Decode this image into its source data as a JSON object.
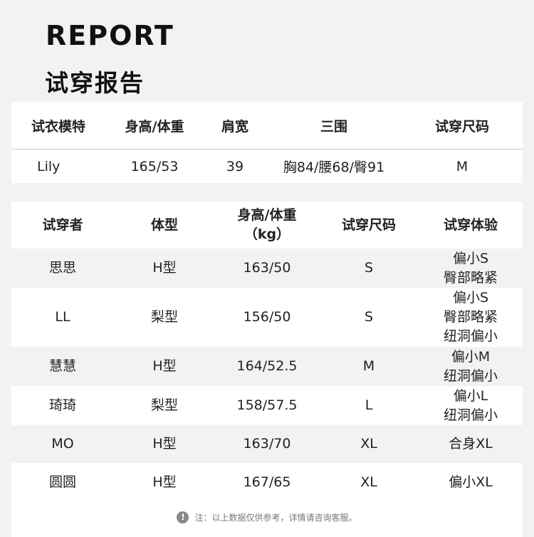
{
  "header": {
    "title_en": "REPORT",
    "title_cn": "试穿报告"
  },
  "model_table": {
    "headers": [
      "试衣模特",
      "身高/体重",
      "肩宽",
      "三围",
      "试穿尺码"
    ],
    "row": [
      "Lily",
      "165/53",
      "39",
      "胸84/腰68/臀91",
      "M"
    ]
  },
  "tryon_table": {
    "headers": {
      "tester": "试穿者",
      "body_type": "体型",
      "height_weight_line1": "身高/体重",
      "height_weight_line2": "（kg）",
      "size": "试穿尺码",
      "experience": "试穿体验"
    },
    "rows": [
      {
        "tester": "思思",
        "body_type": "H型",
        "height_weight": "163/50",
        "size": "S",
        "experience": [
          "偏小S",
          "臀部略紧"
        ]
      },
      {
        "tester": "LL",
        "body_type": "梨型",
        "height_weight": "156/50",
        "size": "S",
        "experience": [
          "偏小S",
          "臀部略紧",
          "纽洞偏小"
        ]
      },
      {
        "tester": "慧慧",
        "body_type": "H型",
        "height_weight": "164/52.5",
        "size": "M",
        "experience": [
          "偏小M",
          "纽洞偏小"
        ]
      },
      {
        "tester": "琦琦",
        "body_type": "梨型",
        "height_weight": "158/57.5",
        "size": "L",
        "experience": [
          "偏小L",
          "纽洞偏小"
        ]
      },
      {
        "tester": "MO",
        "body_type": "H型",
        "height_weight": "163/70",
        "size": "XL",
        "experience": [
          "合身XL"
        ]
      },
      {
        "tester": "圆圆",
        "body_type": "H型",
        "height_weight": "167/65",
        "size": "XL",
        "experience": [
          "偏小XL"
        ]
      }
    ]
  },
  "note": {
    "icon": "exclamation-icon",
    "icon_glyph": "!",
    "text": "注：以上数据仅供参考，详情请咨询客服。"
  },
  "colors": {
    "page_bg": "#f2f2f2",
    "card_bg": "#ffffff",
    "stripe_bg": "#f2f2f2",
    "text": "#222222",
    "note_text": "#777777"
  }
}
